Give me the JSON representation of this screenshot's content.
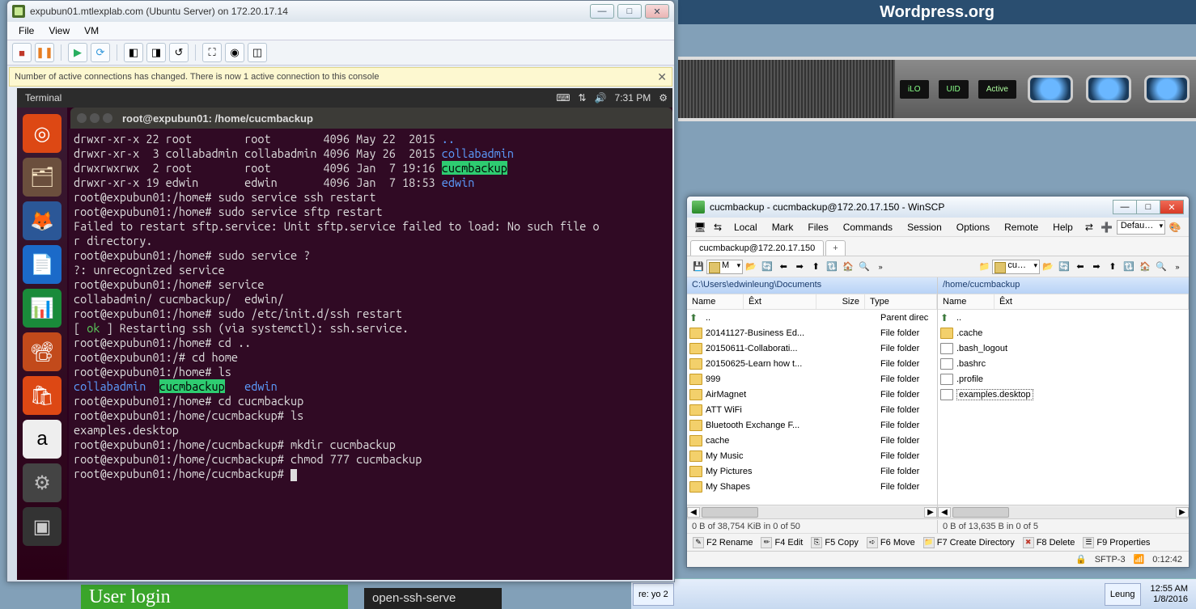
{
  "background": {
    "wordpress": "Wordpress.org",
    "device_labels": [
      "iLO",
      "UID",
      "Active"
    ],
    "user_login": "User login",
    "openssh": "open-ssh-serve"
  },
  "taskbar": {
    "item0": "re: yo 2",
    "item1": "Leung",
    "clock_time": "12:55 AM",
    "clock_date": "1/8/2016"
  },
  "vmware": {
    "title": "expubun01.mtlexplab.com (Ubuntu Server) on 172.20.17.14",
    "menu": {
      "file": "File",
      "view": "View",
      "vm": "VM"
    },
    "info": "Number of active connections has changed. There is now 1 active connection to this console"
  },
  "ubuntu": {
    "topbar_title": "Terminal",
    "topbar_time": "7:31 PM",
    "term_window_title": "root@expubun01: /home/cucmbackup"
  },
  "terminal_lines": [
    {
      "segs": [
        {
          "t": "drwxr-xr-x 22 root        root        4096 May 22  2015 "
        },
        {
          "t": "..",
          "c": "blue"
        }
      ]
    },
    {
      "segs": [
        {
          "t": "drwxr-xr-x  3 collabadmin collabadmin 4096 May 26  2015 "
        },
        {
          "t": "collabadmin",
          "c": "blue"
        }
      ]
    },
    {
      "segs": [
        {
          "t": "drwxrwxrwx  2 root        root        4096 Jan  7 19:16 "
        },
        {
          "t": "cucmbackup",
          "c": "hilite"
        }
      ]
    },
    {
      "segs": [
        {
          "t": "drwxr-xr-x 19 edwin       edwin       4096 Jan  7 18:53 "
        },
        {
          "t": "edwin",
          "c": "blue"
        }
      ]
    },
    {
      "segs": [
        {
          "t": "root@expubun01:/home# sudo service ssh restart"
        }
      ]
    },
    {
      "segs": [
        {
          "t": "root@expubun01:/home# sudo service sftp restart"
        }
      ]
    },
    {
      "segs": [
        {
          "t": "Failed to restart sftp.service: Unit sftp.service failed to load: No such file o"
        }
      ]
    },
    {
      "segs": [
        {
          "t": "r directory."
        }
      ]
    },
    {
      "segs": [
        {
          "t": "root@expubun01:/home# sudo service ?"
        }
      ]
    },
    {
      "segs": [
        {
          "t": "?: unrecognized service"
        }
      ]
    },
    {
      "segs": [
        {
          "t": "root@expubun01:/home# service"
        }
      ]
    },
    {
      "segs": [
        {
          "t": "collabadmin/ cucmbackup/  edwin/"
        }
      ]
    },
    {
      "segs": [
        {
          "t": "root@expubun01:/home# sudo /etc/init.d/ssh restart"
        }
      ]
    },
    {
      "segs": [
        {
          "t": "[ "
        },
        {
          "t": "ok",
          "c": "green-ok"
        },
        {
          "t": " ] Restarting ssh (via systemctl): ssh.service."
        }
      ]
    },
    {
      "segs": [
        {
          "t": "root@expubun01:/home# cd .."
        }
      ]
    },
    {
      "segs": [
        {
          "t": "root@expubun01:/# cd home"
        }
      ]
    },
    {
      "segs": [
        {
          "t": "root@expubun01:/home# ls"
        }
      ]
    },
    {
      "segs": [
        {
          "t": "collabadmin",
          "c": "blue"
        },
        {
          "t": "  "
        },
        {
          "t": "cucmbackup",
          "c": "hilite"
        },
        {
          "t": "   "
        },
        {
          "t": "edwin",
          "c": "blue"
        }
      ]
    },
    {
      "segs": [
        {
          "t": "root@expubun01:/home# cd cucmbackup"
        }
      ]
    },
    {
      "segs": [
        {
          "t": "root@expubun01:/home/cucmbackup# ls"
        }
      ]
    },
    {
      "segs": [
        {
          "t": "examples.desktop"
        }
      ]
    },
    {
      "segs": [
        {
          "t": "root@expubun01:/home/cucmbackup# mkdir cucmbackup"
        }
      ]
    },
    {
      "segs": [
        {
          "t": "root@expubun01:/home/cucmbackup# chmod 777 cucmbackup"
        }
      ]
    },
    {
      "segs": [
        {
          "t": "root@expubun01:/home/cucmbackup# "
        }
      ],
      "cursor": true
    }
  ],
  "winscp": {
    "title": "cucmbackup - cucmbackup@172.20.17.150 - WinSCP",
    "menu": {
      "local": "Local",
      "mark": "Mark",
      "files": "Files",
      "commands": "Commands",
      "session": "Session",
      "options": "Options",
      "remote": "Remote",
      "help": "Help"
    },
    "defau": "Defau…",
    "tab": "cucmbackup@172.20.17.150",
    "local_drive": "M",
    "remote_drive": "cu…",
    "local_path": "C:\\Users\\edwinleung\\Documents",
    "remote_path": "/home/cucmbackup",
    "cols": {
      "name": "Name",
      "ext": "Êxt",
      "size": "Size",
      "type": "Type"
    },
    "local_files": [
      {
        "n": "..",
        "t": "Parent direc",
        "up": true
      },
      {
        "n": "20141127-Business Ed...",
        "t": "File folder"
      },
      {
        "n": "20150611-Collaborati...",
        "t": "File folder"
      },
      {
        "n": "20150625-Learn how t...",
        "t": "File folder"
      },
      {
        "n": "999",
        "t": "File folder"
      },
      {
        "n": "AirMagnet",
        "t": "File folder"
      },
      {
        "n": "ATT WiFi",
        "t": "File folder"
      },
      {
        "n": "Bluetooth Exchange F...",
        "t": "File folder"
      },
      {
        "n": "cache",
        "t": "File folder"
      },
      {
        "n": "My Music",
        "t": "File folder"
      },
      {
        "n": "My Pictures",
        "t": "File folder"
      },
      {
        "n": "My Shapes",
        "t": "File folder"
      }
    ],
    "remote_files": [
      {
        "n": "..",
        "up": true
      },
      {
        "n": ".cache"
      },
      {
        "n": ".bash_logout",
        "file": true
      },
      {
        "n": ".bashrc",
        "file": true
      },
      {
        "n": ".profile",
        "file": true
      },
      {
        "n": "examples.desktop",
        "file": true,
        "sel": true
      }
    ],
    "stats_local": "0 B of 38,754 KiB in 0 of 50",
    "stats_remote": "0 B of 13,635 B in 0 of 5",
    "fn": {
      "f2": "F2 Rename",
      "f4": "F4 Edit",
      "f5": "F5 Copy",
      "f6": "F6 Move",
      "f7": "F7 Create Directory",
      "f8": "F8 Delete",
      "f9": "F9 Properties"
    },
    "status_proto": "SFTP-3",
    "status_time": "0:12:42"
  }
}
